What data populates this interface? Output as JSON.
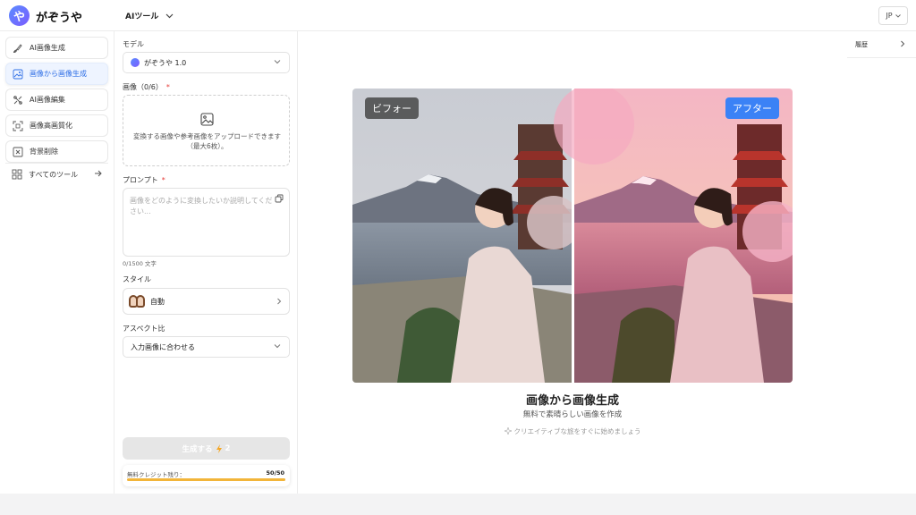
{
  "app": {
    "brand": "がぞうや",
    "logo_char": "や",
    "tool_menu_label": "AIツール",
    "language": "JP"
  },
  "sidebar": {
    "items": [
      {
        "label": "AI画像生成",
        "icon": "brush-icon",
        "active": false
      },
      {
        "label": "画像から画像生成",
        "icon": "image-edit-icon",
        "active": true
      },
      {
        "label": "AI画像編集",
        "icon": "wand-icon",
        "active": false
      },
      {
        "label": "画像高画質化",
        "icon": "upscale-icon",
        "active": false
      },
      {
        "label": "背景削除",
        "icon": "background-remove-icon",
        "active": false
      }
    ],
    "all_tools_label": "すべてのツール"
  },
  "panel": {
    "model_label": "モデル",
    "model_value": "がぞうや 1.0",
    "image_label": "画像（0/6）",
    "upload_text": "変換する画像や参考画像をアップロードできます（最大6枚）。",
    "prompt_label": "プロンプト",
    "prompt_placeholder": "画像をどのように変換したいか説明してください...",
    "prompt_counter": "0/1500 文字",
    "style_label": "スタイル",
    "style_value": "自動",
    "aspect_label": "アスペクト比",
    "aspect_value": "入力画像に合わせる",
    "generate_label": "生成する",
    "generate_cost": "2",
    "credits_label": "無料クレジット残り：",
    "credits_value": "50/50",
    "credits_fraction": 1.0
  },
  "main": {
    "before_label": "ビフォー",
    "after_label": "アフター",
    "title": "画像から画像生成",
    "subtitle": "無料で素晴らしい画像を作成",
    "hint": "クリエイティブな旅をすぐに始めましょう"
  },
  "history": {
    "label": "履歴"
  },
  "colors": {
    "accent": "#3b82f6",
    "active_bg": "#eef4ff",
    "credit_bar": "#f2b53a"
  }
}
